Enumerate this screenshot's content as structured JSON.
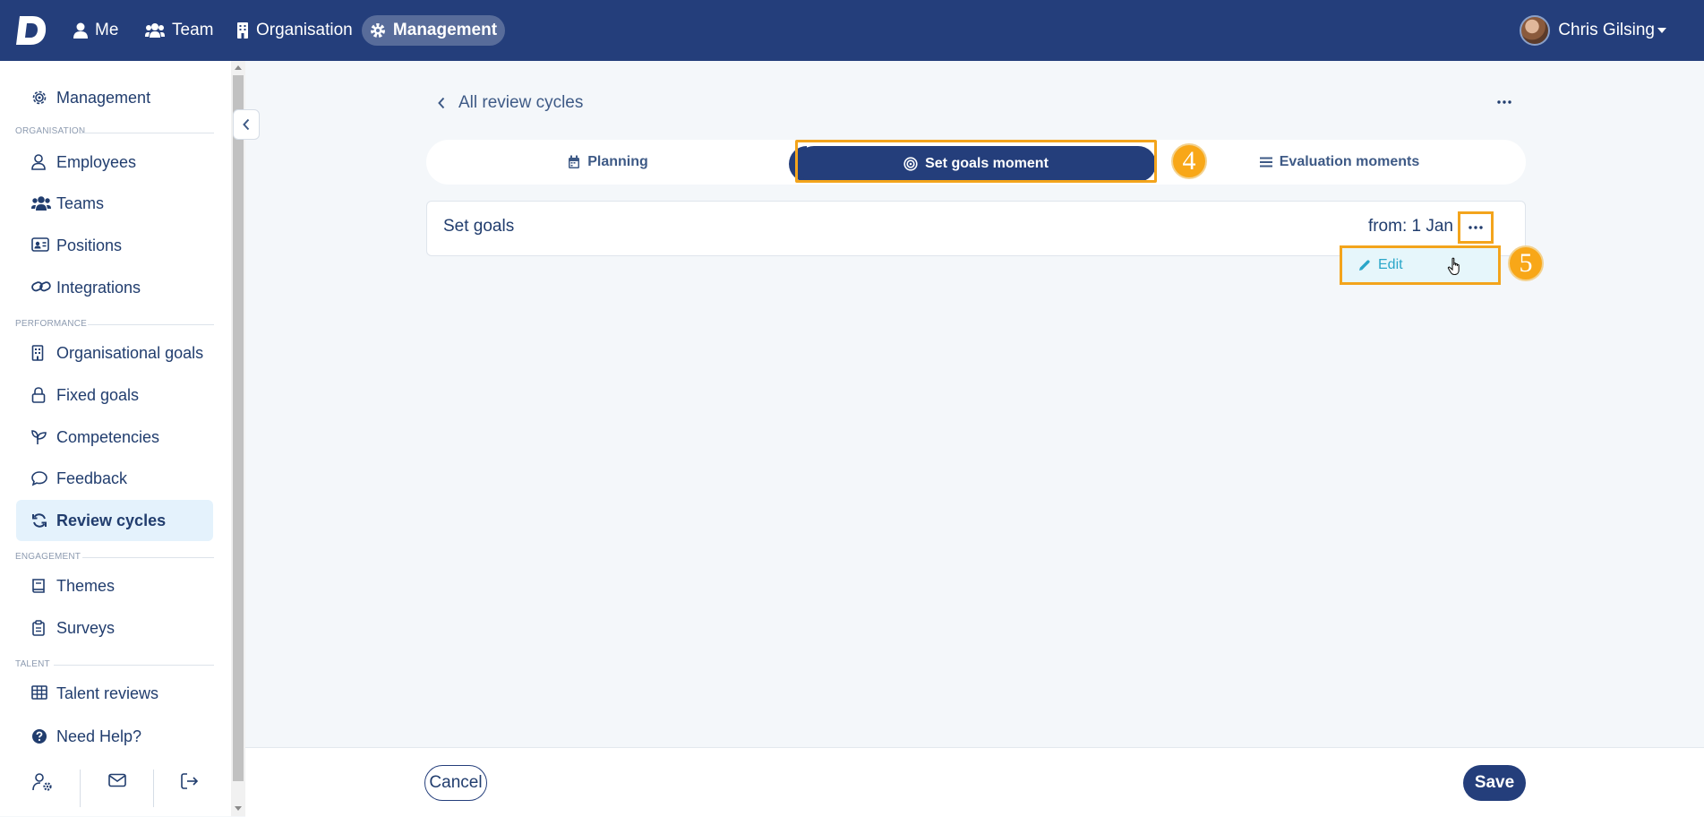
{
  "topbar": {
    "nav": [
      {
        "label": "Me",
        "icon": "user-icon"
      },
      {
        "label": "Team",
        "icon": "users-icon"
      },
      {
        "label": "Organisation",
        "icon": "building-icon"
      },
      {
        "label": "Management",
        "icon": "gear-icon",
        "active": true
      }
    ],
    "user_name": "Chris Gilsing"
  },
  "sidebar": {
    "header": {
      "label": "Management",
      "icon": "gear-icon"
    },
    "sections": [
      {
        "label": "ORGANISATION",
        "items": [
          {
            "label": "Employees",
            "icon": "user-icon"
          },
          {
            "label": "Teams",
            "icon": "users-icon"
          },
          {
            "label": "Positions",
            "icon": "id-card-icon"
          },
          {
            "label": "Integrations",
            "icon": "link-icon"
          }
        ]
      },
      {
        "label": "PERFORMANCE",
        "items": [
          {
            "label": "Organisational goals",
            "icon": "building-icon"
          },
          {
            "label": "Fixed goals",
            "icon": "lock-icon"
          },
          {
            "label": "Competencies",
            "icon": "seedling-icon"
          },
          {
            "label": "Feedback",
            "icon": "chat-icon"
          },
          {
            "label": "Review cycles",
            "icon": "refresh-icon",
            "active": true
          }
        ]
      },
      {
        "label": "ENGAGEMENT",
        "items": [
          {
            "label": "Themes",
            "icon": "book-icon"
          },
          {
            "label": "Surveys",
            "icon": "clipboard-icon"
          }
        ]
      },
      {
        "label": "TALENT",
        "items": [
          {
            "label": "Talent reviews",
            "icon": "table-icon"
          }
        ]
      }
    ],
    "help": {
      "label": "Need Help?",
      "icon": "question-circle-icon"
    },
    "footer_icons": [
      "user-settings-icon",
      "mail-icon",
      "logout-icon"
    ]
  },
  "main": {
    "back_label": "All review cycles",
    "tabs": [
      {
        "label": "Planning",
        "icon": "calendar-icon"
      },
      {
        "label": "Set goals moment",
        "icon": "target-icon",
        "active": true
      },
      {
        "label": "Evaluation moments",
        "icon": "list-icon"
      }
    ],
    "card": {
      "title": "Set goals",
      "from": "from: 1 Jan"
    },
    "menu": {
      "edit_label": "Edit",
      "icon": "pencil-icon"
    },
    "annotations": [
      "4",
      "5"
    ],
    "footer": {
      "cancel_label": "Cancel",
      "save_label": "Save"
    }
  },
  "colors": {
    "primary": "#243e7b",
    "highlight": "#f3a41c",
    "badge": "#f8a718",
    "active_bg": "#e4f2fc",
    "edit_text": "#2aa6c9"
  }
}
